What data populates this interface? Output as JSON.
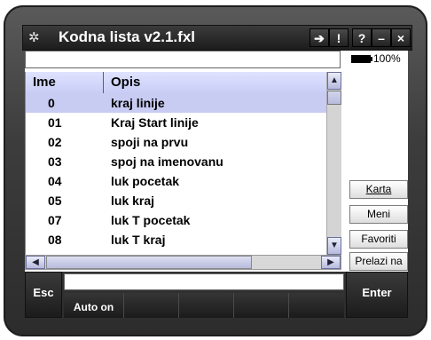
{
  "window": {
    "title": "Kodna lista v2.1.fxl",
    "buttons": {
      "arrow": "➔",
      "info": "!",
      "help": "?",
      "minimize": "–",
      "close": "×"
    }
  },
  "status": {
    "battery": "100%"
  },
  "table": {
    "headers": {
      "ime": "Ime",
      "opis": "Opis"
    },
    "rows": [
      {
        "ime": "0",
        "opis": "kraj linije"
      },
      {
        "ime": "01",
        "opis": "Kraj Start linije"
      },
      {
        "ime": "02",
        "opis": "spoji na prvu"
      },
      {
        "ime": "03",
        "opis": "spoj na imenovanu"
      },
      {
        "ime": "04",
        "opis": "luk pocetak"
      },
      {
        "ime": "05",
        "opis": "luk kraj"
      },
      {
        "ime": "07",
        "opis": "luk T pocetak"
      },
      {
        "ime": "08",
        "opis": "luk T kraj"
      }
    ],
    "selected_index": 0
  },
  "side_buttons": {
    "karta": "Karta",
    "meni": "Meni",
    "favoriti": "Favoriti",
    "prelazi_na": "Prelazi na"
  },
  "bottom": {
    "esc": "Esc",
    "auto_on": "Auto on",
    "enter": "Enter"
  }
}
